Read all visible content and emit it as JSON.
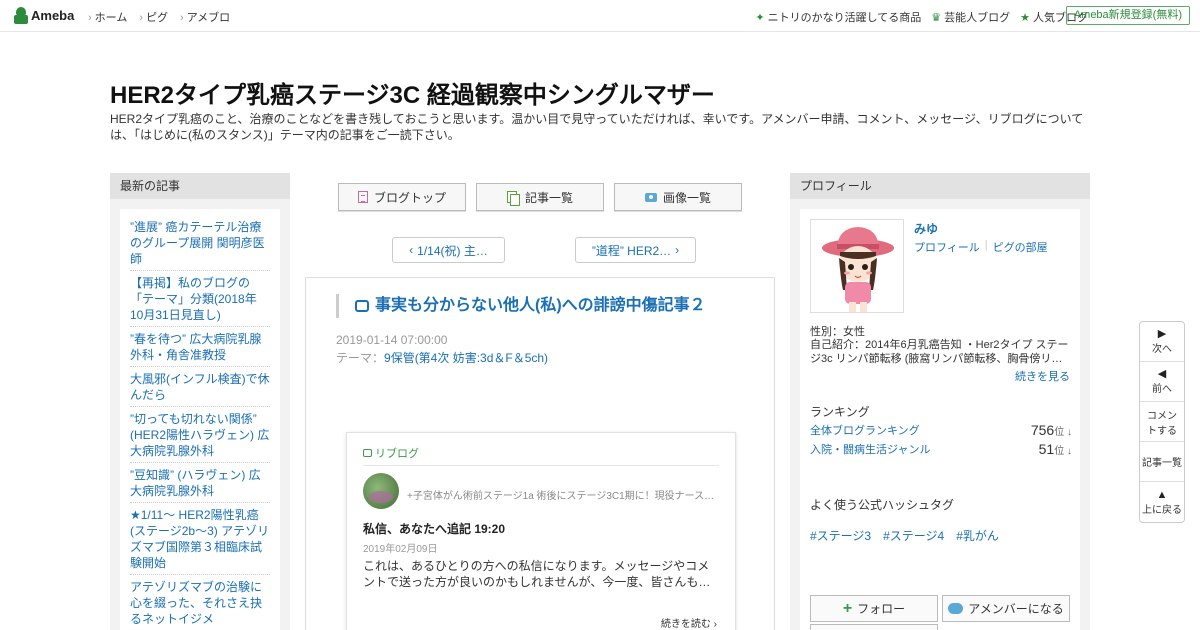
{
  "topbar": {
    "logo": "Ameba",
    "nav": [
      "ホーム",
      "ピグ",
      "アメブロ"
    ],
    "right_links": [
      {
        "icon": "sparkle-icon",
        "label": "ニトリのかなり活躍してる商品"
      },
      {
        "icon": "crown-icon",
        "label": "芸能人ブログ"
      },
      {
        "icon": "star-icon",
        "label": "人気ブログ"
      }
    ],
    "register": "Ameba新規登録(無料)"
  },
  "header": {
    "title": "HER2タイプ乳癌ステージ3C 経過観察中シングルマザー",
    "description": "HER2タイプ乳癌のこと、治療のことなどを書き残しておこうと思います。温かい目で見守っていただければ、幸いです。アメンバー申請、コメント、メッセージ、リブログについては、「はじめに(私のスタンス)」テーマ内の記事をご一読下さい。"
  },
  "left_sidebar": {
    "heading": "最新の記事",
    "items": [
      "”進展” 癌カテーテル治療のグループ展開 関明彦医師",
      "【再掲】私のブログの「テーマ」分類(2018年10月31日見直し)",
      "”春を待つ” 広大病院乳腺外科・角舎准教授",
      "大風邪(インフル検査)で休んだら",
      "”切っても切れない関係” (HER2陽性ハラヴェン) 広大病院乳腺外科",
      "”豆知識” (ハラヴェン) 広大病院乳腺外科",
      "★1/11～ HER2陽性乳癌(ステージ2b～3) アテゾリズマブ国際第３相臨床試験開始",
      "アテゾリズマブの治験に心を綴った、それさえ抉るネットイジメ"
    ]
  },
  "center": {
    "buttons": [
      "ブログトップ",
      "記事一覧",
      "画像一覧"
    ],
    "pager_prev": "1/14(祝) 主…",
    "pager_next": "”道程” HER2…",
    "article": {
      "title": "事実も分からない他人(私)への誹謗中傷記事２",
      "date": "2019-01-14 07:00:00",
      "theme_label": "テーマ：",
      "theme": "9保管(第4次 妨害:3d＆F＆5ch)"
    },
    "reblog": {
      "label": "リブログ",
      "blog_name": "+子宮体がん術前ステージ1a 術後にステージ3C1期に！現役ナース…",
      "title": "私信、あなたへ追記 19:20",
      "date": "2019年02月09日",
      "excerpt": "これは、あるひとりの方への私信になります。メッセージやコメントで送った方が良いのかもしれませんが、今一度、皆さんも…",
      "more": "続きを読む"
    }
  },
  "right_sidebar": {
    "heading": "プロフィール",
    "name": "みゆ",
    "links": [
      "プロフィール",
      "ピグの部屋"
    ],
    "gender": "性別：女性",
    "intro": "自己紹介：2014年6月乳癌告知 ・Her2タイプ ステージ3c リンパ節転移 (腋窩リンパ節転移、胸骨傍リ…",
    "more": "続きを見る",
    "ranking_heading": "ランキング",
    "rankings": [
      {
        "label": "全体ブログランキング",
        "rank": "756",
        "unit": "位 ↓"
      },
      {
        "label": "入院・闘病生活ジャンル",
        "rank": "51",
        "unit": "位 ↓"
      }
    ],
    "hashtag_heading": "よく使う公式ハッシュタグ",
    "hashtags": [
      "#ステージ3",
      "#ステージ4",
      "#乳がん"
    ],
    "follow": "フォロー",
    "amember": "アメンバーになる"
  },
  "float_nav": {
    "next": "次へ",
    "prev": "前へ",
    "comment": "コメントする",
    "list": "記事一覧",
    "top": "上に戻る"
  }
}
